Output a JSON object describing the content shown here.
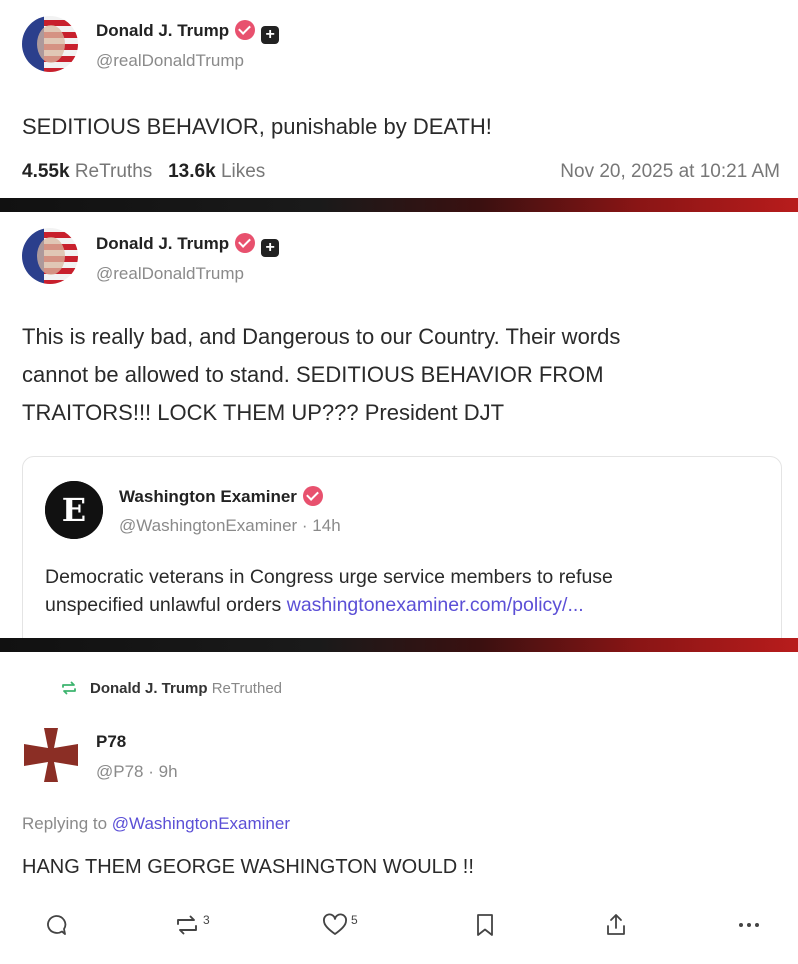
{
  "post1": {
    "name": "Donald J. Trump",
    "handle": "@realDonaldTrump",
    "text": "SEDITIOUS BEHAVIOR, punishable by DEATH!",
    "retruths_count": "4.55k",
    "retruths_label": "ReTruths",
    "likes_count": "13.6k",
    "likes_label": "Likes",
    "date": "Nov 20, 2025 at 10:21 AM"
  },
  "post2": {
    "name": "Donald J. Trump",
    "handle": "@realDonaldTrump",
    "text_line1": "This is really bad, and Dangerous to our Country. Their words",
    "text_line2": "cannot be allowed to stand. SEDITIOUS BEHAVIOR FROM",
    "text_line3": "TRAITORS!!! LOCK THEM UP??? President DJT",
    "quote": {
      "name": "Washington Examiner",
      "handle": "@WashingtonExaminer · 14h",
      "text_line1": "Democratic veterans in Congress urge service members to refuse",
      "text_line2": "unspecified unlawful orders",
      "link": "washingtonexaminer.com/policy/..."
    }
  },
  "post3": {
    "retruth_name": "Donald J. Trump",
    "retruth_label": "ReTruthed",
    "name": "P78",
    "handle": "@P78 · 9h",
    "replying_label": "Replying to",
    "replying_handle": "@WashingtonExaminer",
    "text": "HANG THEM GEORGE WASHINGTON WOULD !!",
    "actions": {
      "reply_icon": "speech-bubble-icon",
      "retruth_count": "3",
      "like_count": "5"
    }
  },
  "colors": {
    "badge": "#e8516e",
    "link": "#5b4fd6",
    "retruth_green": "#3cb46e",
    "cross": "#8b2e25"
  }
}
